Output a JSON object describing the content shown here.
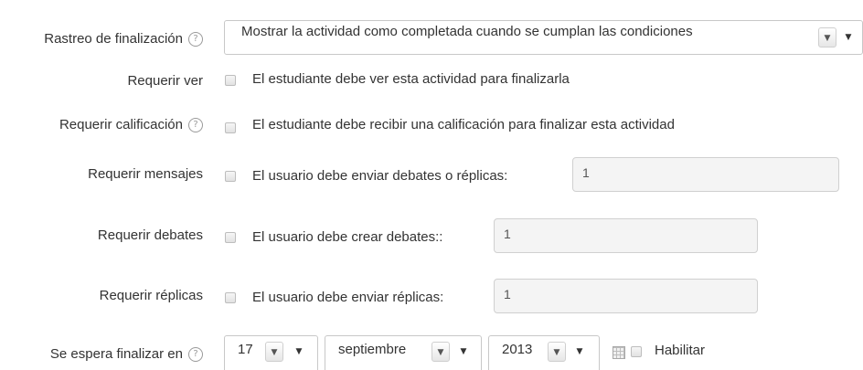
{
  "completion": {
    "label": "Rastreo de finalización",
    "select_value": "Mostrar la actividad como completada cuando se cumplan las condiciones"
  },
  "require_view": {
    "label": "Requerir ver",
    "text": "El estudiante debe ver esta actividad para finalizarla"
  },
  "require_grade": {
    "label": "Requerir calificación",
    "text": "El estudiante debe recibir una calificación para finalizar esta actividad"
  },
  "require_posts": {
    "label": "Requerir mensajes",
    "text": "El usuario debe enviar debates o réplicas:",
    "value": "1"
  },
  "require_discussions": {
    "label": "Requerir debates",
    "text": "El usuario debe crear debates::",
    "value": "1"
  },
  "require_replies": {
    "label": "Requerir réplicas",
    "text": "El usuario debe enviar réplicas:",
    "value": "1"
  },
  "expected": {
    "label": "Se espera finalizar en",
    "day": "17",
    "month": "septiembre",
    "year": "2013",
    "enable_label": "Habilitar"
  },
  "icons": {
    "help": "?",
    "arrow_small": "▼",
    "arrow": "▼",
    "calendar": "calendar-icon"
  }
}
